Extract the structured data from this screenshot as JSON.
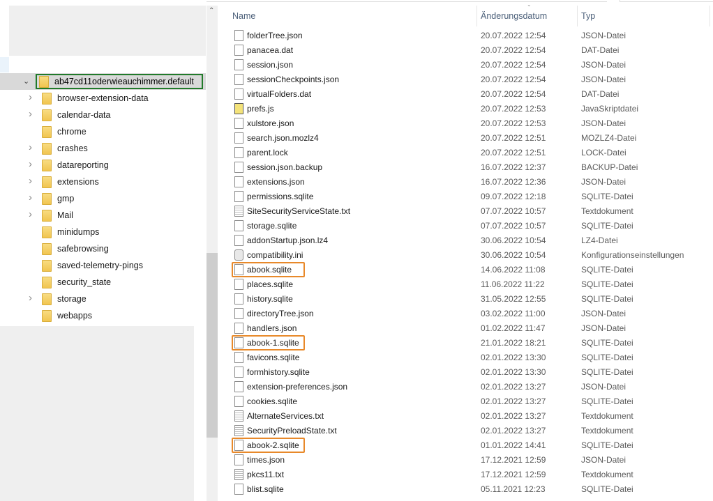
{
  "tree": {
    "root": "ab47cd11oderwieauchimmer.default",
    "items": [
      {
        "label": "browser-extension-data",
        "expandable": true
      },
      {
        "label": "calendar-data",
        "expandable": true
      },
      {
        "label": "chrome",
        "expandable": false
      },
      {
        "label": "crashes",
        "expandable": true
      },
      {
        "label": "datareporting",
        "expandable": true
      },
      {
        "label": "extensions",
        "expandable": true
      },
      {
        "label": "gmp",
        "expandable": true
      },
      {
        "label": "Mail",
        "expandable": true
      },
      {
        "label": "minidumps",
        "expandable": false
      },
      {
        "label": "safebrowsing",
        "expandable": false
      },
      {
        "label": "saved-telemetry-pings",
        "expandable": false
      },
      {
        "label": "security_state",
        "expandable": false
      },
      {
        "label": "storage",
        "expandable": true
      },
      {
        "label": "webapps",
        "expandable": false
      }
    ]
  },
  "columns": {
    "name": "Name",
    "date": "Änderungsdatum",
    "type": "Typ"
  },
  "files": [
    {
      "name": "folderTree.json",
      "date": "20.07.2022 12:54",
      "type": "JSON-Datei",
      "icon": "file"
    },
    {
      "name": "panacea.dat",
      "date": "20.07.2022 12:54",
      "type": "DAT-Datei",
      "icon": "file"
    },
    {
      "name": "session.json",
      "date": "20.07.2022 12:54",
      "type": "JSON-Datei",
      "icon": "file"
    },
    {
      "name": "sessionCheckpoints.json",
      "date": "20.07.2022 12:54",
      "type": "JSON-Datei",
      "icon": "file"
    },
    {
      "name": "virtualFolders.dat",
      "date": "20.07.2022 12:54",
      "type": "DAT-Datei",
      "icon": "file"
    },
    {
      "name": "prefs.js",
      "date": "20.07.2022 12:53",
      "type": "JavaSkriptdatei",
      "icon": "js"
    },
    {
      "name": "xulstore.json",
      "date": "20.07.2022 12:53",
      "type": "JSON-Datei",
      "icon": "file"
    },
    {
      "name": "search.json.mozlz4",
      "date": "20.07.2022 12:51",
      "type": "MOZLZ4-Datei",
      "icon": "file"
    },
    {
      "name": "parent.lock",
      "date": "20.07.2022 12:51",
      "type": "LOCK-Datei",
      "icon": "file"
    },
    {
      "name": "session.json.backup",
      "date": "16.07.2022 12:37",
      "type": "BACKUP-Datei",
      "icon": "file"
    },
    {
      "name": "extensions.json",
      "date": "16.07.2022 12:36",
      "type": "JSON-Datei",
      "icon": "file"
    },
    {
      "name": "permissions.sqlite",
      "date": "09.07.2022 12:18",
      "type": "SQLITE-Datei",
      "icon": "file"
    },
    {
      "name": "SiteSecurityServiceState.txt",
      "date": "07.07.2022 10:57",
      "type": "Textdokument",
      "icon": "txt"
    },
    {
      "name": "storage.sqlite",
      "date": "07.07.2022 10:57",
      "type": "SQLITE-Datei",
      "icon": "file"
    },
    {
      "name": "addonStartup.json.lz4",
      "date": "30.06.2022 10:54",
      "type": "LZ4-Datei",
      "icon": "file"
    },
    {
      "name": "compatibility.ini",
      "date": "30.06.2022 10:54",
      "type": "Konfigurationseinstellungen",
      "icon": "ini"
    },
    {
      "name": "abook.sqlite",
      "date": "14.06.2022 11:08",
      "type": "SQLITE-Datei",
      "icon": "file",
      "highlight": true
    },
    {
      "name": "places.sqlite",
      "date": "11.06.2022 11:22",
      "type": "SQLITE-Datei",
      "icon": "file"
    },
    {
      "name": "history.sqlite",
      "date": "31.05.2022 12:55",
      "type": "SQLITE-Datei",
      "icon": "file"
    },
    {
      "name": "directoryTree.json",
      "date": "03.02.2022 11:00",
      "type": "JSON-Datei",
      "icon": "file"
    },
    {
      "name": "handlers.json",
      "date": "01.02.2022 11:47",
      "type": "JSON-Datei",
      "icon": "file"
    },
    {
      "name": "abook-1.sqlite",
      "date": "21.01.2022 18:21",
      "type": "SQLITE-Datei",
      "icon": "file",
      "highlight": true
    },
    {
      "name": "favicons.sqlite",
      "date": "02.01.2022 13:30",
      "type": "SQLITE-Datei",
      "icon": "file"
    },
    {
      "name": "formhistory.sqlite",
      "date": "02.01.2022 13:30",
      "type": "SQLITE-Datei",
      "icon": "file"
    },
    {
      "name": "extension-preferences.json",
      "date": "02.01.2022 13:27",
      "type": "JSON-Datei",
      "icon": "file"
    },
    {
      "name": "cookies.sqlite",
      "date": "02.01.2022 13:27",
      "type": "SQLITE-Datei",
      "icon": "file"
    },
    {
      "name": "AlternateServices.txt",
      "date": "02.01.2022 13:27",
      "type": "Textdokument",
      "icon": "txt"
    },
    {
      "name": "SecurityPreloadState.txt",
      "date": "02.01.2022 13:27",
      "type": "Textdokument",
      "icon": "txt"
    },
    {
      "name": "abook-2.sqlite",
      "date": "01.01.2022 14:41",
      "type": "SQLITE-Datei",
      "icon": "file",
      "highlight": true
    },
    {
      "name": "times.json",
      "date": "17.12.2021 12:59",
      "type": "JSON-Datei",
      "icon": "file"
    },
    {
      "name": "pkcs11.txt",
      "date": "17.12.2021 12:59",
      "type": "Textdokument",
      "icon": "txt"
    },
    {
      "name": "blist.sqlite",
      "date": "05.11.2021 12:23",
      "type": "SQLITE-Datei",
      "icon": "file"
    }
  ]
}
